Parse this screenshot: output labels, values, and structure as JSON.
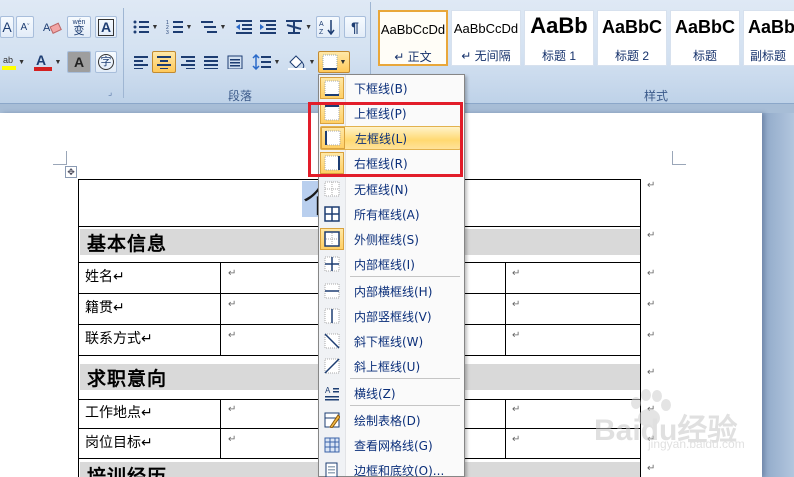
{
  "ribbon": {
    "paragraph_group_label": "段落",
    "styles_group_label": "样式",
    "styles": [
      {
        "sample": "AaBbCcDd",
        "name": "↵ 正文",
        "selected": true
      },
      {
        "sample": "AaBbCcDd",
        "name": "↵ 无间隔",
        "selected": false
      },
      {
        "sample": "AaBb",
        "name": "标题 1",
        "selected": false
      },
      {
        "sample": "AaBbC",
        "name": "标题 2",
        "selected": false
      },
      {
        "sample": "AaBbC",
        "name": "标题",
        "selected": false
      },
      {
        "sample": "AaBbC",
        "name": "副标题",
        "selected": false
      }
    ],
    "font_tools": {
      "phonetic_guide_label": "wén",
      "phonetic_guide_char": "变",
      "char_border_label": "A",
      "char_shading_label": "A",
      "enclosed_char_label": "字",
      "font_color_label": "A",
      "highlight_label": "ab"
    }
  },
  "border_menu": {
    "items": [
      {
        "label": "下框线(B)",
        "icon": "border-bottom-icon",
        "checked": true
      },
      {
        "label": "上框线(P)",
        "icon": "border-top-icon",
        "checked": true
      },
      {
        "label": "左框线(L)",
        "icon": "border-left-icon",
        "checked": true,
        "hover": true
      },
      {
        "label": "右框线(R)",
        "icon": "border-right-icon",
        "checked": true
      },
      {
        "label": "无框线(N)",
        "icon": "border-none-icon",
        "checked": false
      },
      {
        "label": "所有框线(A)",
        "icon": "border-all-icon",
        "checked": false
      },
      {
        "label": "外侧框线(S)",
        "icon": "border-outside-icon",
        "checked": true
      },
      {
        "label": "内部框线(I)",
        "icon": "border-inside-icon",
        "checked": false
      },
      {
        "label": "内部横框线(H)",
        "icon": "border-inside-horizontal-icon",
        "checked": false
      },
      {
        "label": "内部竖框线(V)",
        "icon": "border-inside-vertical-icon",
        "checked": false
      },
      {
        "label": "斜下框线(W)",
        "icon": "diagonal-down-border-icon",
        "checked": false
      },
      {
        "label": "斜上框线(U)",
        "icon": "diagonal-up-border-icon",
        "checked": false
      },
      {
        "label": "横线(Z)",
        "icon": "horizontal-line-icon",
        "checked": false
      },
      {
        "label": "绘制表格(D)",
        "icon": "draw-table-icon",
        "checked": false
      },
      {
        "label": "查看网格线(G)",
        "icon": "view-gridlines-icon",
        "checked": false
      },
      {
        "label": "边框和底纹(O)...",
        "icon": "borders-shading-icon",
        "checked": false
      }
    ]
  },
  "document": {
    "title_partial": "个",
    "sections": [
      {
        "title": "基本信息"
      },
      {
        "title": "求职意向"
      },
      {
        "title": "培训经历"
      }
    ],
    "rows": [
      {
        "label": "姓名↵"
      },
      {
        "label": "籍贯↵"
      },
      {
        "label": "联系方式↵"
      },
      {
        "label": "工作地点↵"
      },
      {
        "label": "岗位目标↵"
      }
    ],
    "cell_mark": "↵",
    "table_handle_glyph": "✥"
  },
  "watermark": {
    "brand": "Baidu经验",
    "url": "jingyan.baidu.com"
  }
}
